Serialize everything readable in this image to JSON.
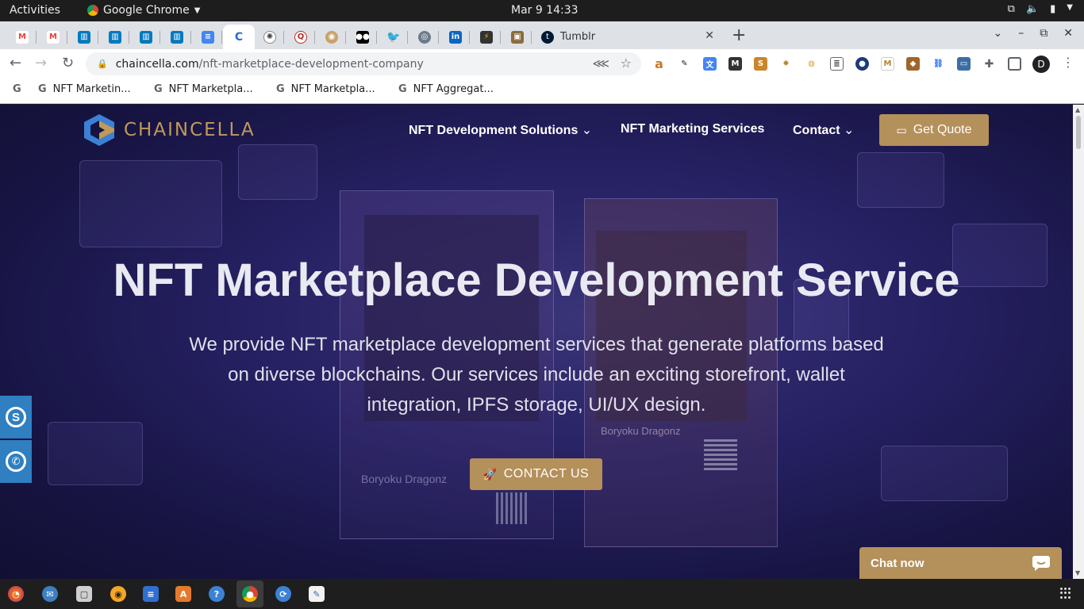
{
  "system": {
    "activities": "Activities",
    "app_name": "Google Chrome",
    "clock": "Mar 9  14:33"
  },
  "browser": {
    "active_tab_title": "Tumblr",
    "url_host": "chaincella.com",
    "url_path": "/nft-marketplace-development-company",
    "profile_initial": "D",
    "bookmarks": [
      {
        "label": "NFT Marketin..."
      },
      {
        "label": "NFT Marketpla..."
      },
      {
        "label": "NFT Marketpla..."
      },
      {
        "label": "NFT Aggregat..."
      }
    ]
  },
  "site": {
    "brand": "CHAINCELLA",
    "nav": {
      "solutions": "NFT Development Solutions",
      "marketing": "NFT Marketing Services",
      "contact": "Contact"
    },
    "quote_button": "Get Quote",
    "hero_title": "NFT Marketplace Development Service",
    "hero_desc": "We provide NFT marketplace development services that generate platforms based on diverse blockchains. Our services include an exciting storefront, wallet integration, IPFS storage, UI/UX design.",
    "cta_label": "CONTACT US",
    "chat_label": "Chat now",
    "card_left_name": "Boryoku Dragonz",
    "card_right_name": "Boryoku Dragonz"
  },
  "colors": {
    "accent_gold": "#b4905a",
    "hero_bg": "#262163",
    "side_button_blue": "#2f7fc1"
  }
}
